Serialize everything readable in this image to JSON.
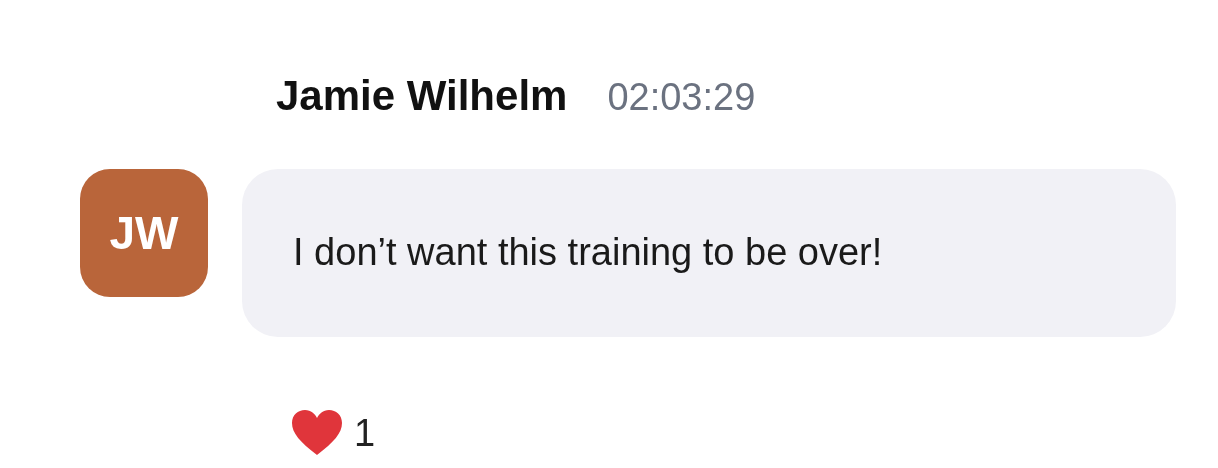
{
  "message": {
    "author": "Jamie Wilhelm",
    "time": "02:03:29",
    "initials": "JW",
    "text": "I don’t want this training to be over!",
    "reactions": [
      {
        "kind": "heart",
        "count": "1"
      }
    ]
  }
}
